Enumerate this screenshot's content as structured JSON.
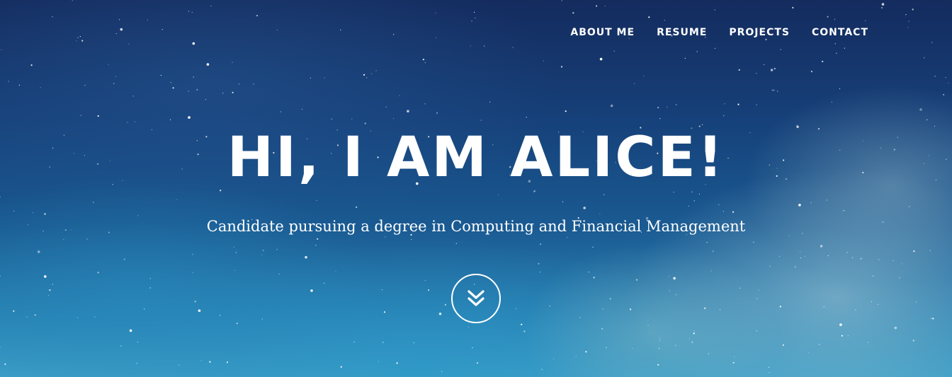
{
  "nav": {
    "items": [
      {
        "label": "ABOUT ME"
      },
      {
        "label": "RESUME"
      },
      {
        "label": "PROJECTS"
      },
      {
        "label": "CONTACT"
      }
    ]
  },
  "hero": {
    "title": "HI, I AM ALICE!",
    "subtitle": "Candidate pursuing a degree in Computing and Financial Management",
    "scroll_icon": "double-chevron-down-icon"
  },
  "colors": {
    "text": "#ffffff",
    "sky_top": "#142b5e",
    "sky_bottom": "#3d9ec6"
  }
}
